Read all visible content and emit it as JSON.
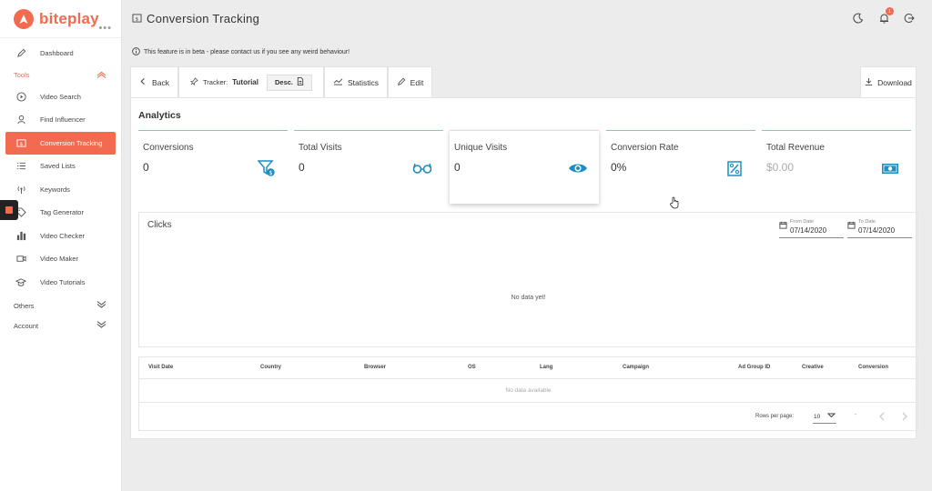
{
  "brand": {
    "name": "biteplay"
  },
  "sidebar": {
    "dashboard": "Dashboard",
    "tools_label": "Tools",
    "tools_items": [
      {
        "label": "Video Search",
        "icon": "play-circle-icon"
      },
      {
        "label": "Find Influencer",
        "icon": "influencer-icon"
      },
      {
        "label": "Conversion Tracking",
        "icon": "dollar-card-icon",
        "active": true
      },
      {
        "label": "Saved Lists",
        "icon": "list-icon"
      },
      {
        "label": "Keywords",
        "icon": "antenna-icon"
      },
      {
        "label": "Tag Generator",
        "icon": "tag-icon"
      },
      {
        "label": "Video Checker",
        "icon": "bar-chart-icon"
      },
      {
        "label": "Video Maker",
        "icon": "video-camera-icon"
      },
      {
        "label": "Video Tutorials",
        "icon": "graduation-cap-icon"
      }
    ],
    "others_label": "Others",
    "account_label": "Account"
  },
  "header": {
    "title": "Conversion Tracking",
    "beta_notice": "This feature is in beta - please contact us if you see any weird behaviour!",
    "notification_count": "1"
  },
  "toolbar": {
    "back": "Back",
    "tracker_label": "Tracker:",
    "tracker_name": "Tutorial",
    "desc": "Desc.",
    "statistics": "Statistics",
    "edit": "Edit",
    "download": "Download"
  },
  "analytics": {
    "title": "Analytics",
    "stats": [
      {
        "label": "Conversions",
        "value": "0",
        "icon": "funnel-dollar-icon"
      },
      {
        "label": "Total Visits",
        "value": "0",
        "icon": "glasses-icon"
      },
      {
        "label": "Unique Visits",
        "value": "0",
        "icon": "eye-icon"
      },
      {
        "label": "Conversion Rate",
        "value": "0%",
        "icon": "percent-icon"
      },
      {
        "label": "Total Revenue",
        "value": "$0.00",
        "icon": "money-icon"
      }
    ]
  },
  "clicks": {
    "title": "Clicks",
    "from_label": "From Date",
    "from_value": "07/14/2020",
    "to_label": "To Date",
    "to_value": "07/14/2020",
    "no_data": "No data yet!"
  },
  "table": {
    "columns": [
      "Visit Date",
      "Country",
      "Browser",
      "OS",
      "Lang",
      "Campaign",
      "Ad Group ID",
      "Creative",
      "Conversion"
    ],
    "empty": "No data available",
    "rows_per_page_label": "Rows per page:",
    "rows_per_page": "10",
    "range": "-"
  },
  "colors": {
    "brand": "#f26a50",
    "accent": "#1c8fc0"
  }
}
